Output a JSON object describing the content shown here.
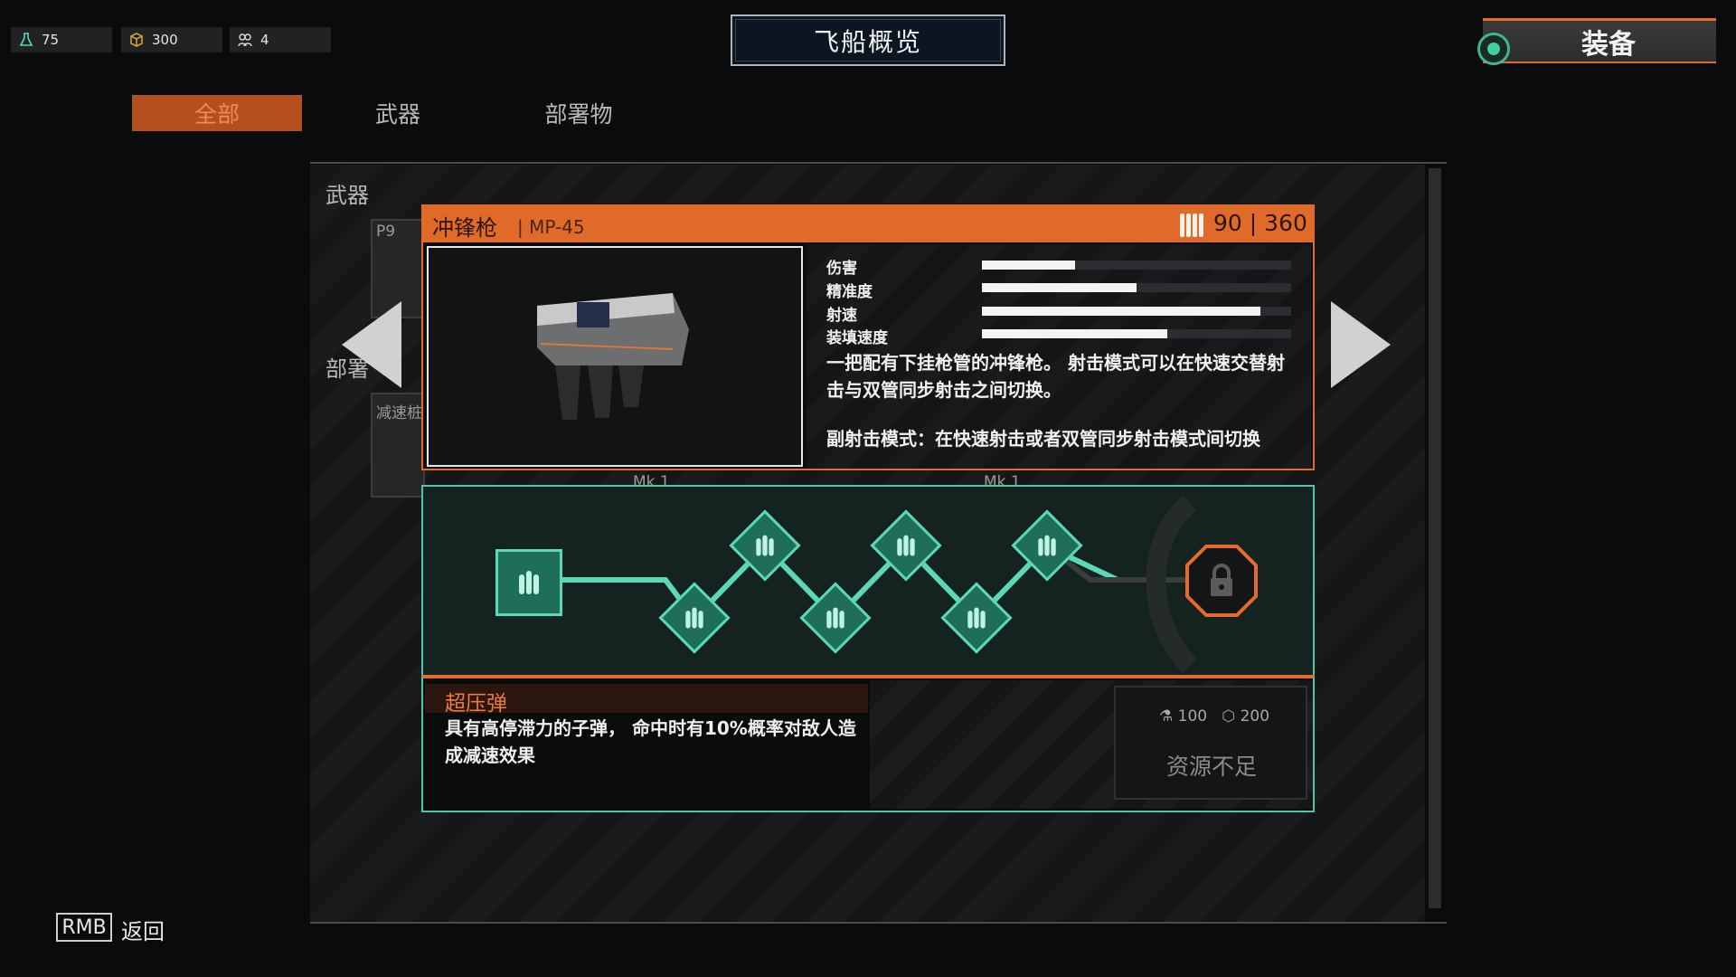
{
  "resources": [
    {
      "icon": "flask-icon",
      "value": "75"
    },
    {
      "icon": "cube-icon",
      "value": "300"
    },
    {
      "icon": "crew-icon",
      "value": "4"
    }
  ],
  "header": {
    "title": "飞船概览",
    "equip_label": "装备"
  },
  "tabs": [
    "全部",
    "武器",
    "部署物"
  ],
  "sections": {
    "weapons": "武器",
    "deployables_partial": "部署"
  },
  "slots": {
    "weapon_slot_label": "P9",
    "deploy_slot_label": "减速桩",
    "mk_label": "Mk 1"
  },
  "weapon": {
    "name": "冲锋枪",
    "model": "| MP-45",
    "ammo": "90 | 360",
    "stats": [
      {
        "label": "伤害",
        "value": 0.3
      },
      {
        "label": "精准度",
        "value": 0.5
      },
      {
        "label": "射速",
        "value": 0.9
      },
      {
        "label": "装填速度",
        "value": 0.6
      }
    ],
    "description": "一把配有下挂枪管的冲锋枪。 射击模式可以在快速交替射击与双管同步射击之间切换。",
    "secondary": "副射击模式：在快速射击或者双管同步射击模式间切换"
  },
  "upgrade": {
    "name": "超压弹",
    "description": "具有高停滞力的子弹， 命中时有10%概率对敌人造成减速效果",
    "cost_a": "100",
    "cost_b": "200",
    "status": "资源不足"
  },
  "footer": {
    "key": "RMB",
    "action": "返回"
  },
  "colors": {
    "accent": "#e06a2a",
    "teal": "#5bd9b5",
    "bg": "#0a0b0c"
  }
}
